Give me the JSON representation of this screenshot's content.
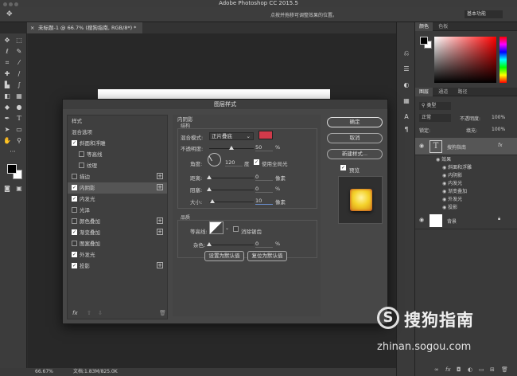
{
  "app": {
    "title": "Adobe Photoshop CC 2015.5"
  },
  "options_bar": {
    "hint": "点按并拖移可调整效果的位置。",
    "workspace": "基本功能"
  },
  "document": {
    "tab": "未标题-1 @ 66.7% (搜狗指南, RGB/8*) *"
  },
  "status": {
    "zoom": "66.67%",
    "doc": "文档:1.83M/825.0K"
  },
  "colors": {
    "accent_red": "#d03a4a",
    "fg": "#000000",
    "bg": "#ffffff"
  },
  "color_panel": {
    "tabs": [
      "颜色",
      "色板"
    ]
  },
  "layers_panel": {
    "tabs": [
      "图层",
      "通道",
      "路径"
    ],
    "kind": "类型",
    "blend": "正常",
    "opacity_label": "不透明度:",
    "opacity": "100%",
    "lock_label": "锁定:",
    "fill_label": "填充:",
    "fill": "100%",
    "text_layer": "搜狗指南",
    "effects_label": "效果",
    "effects": [
      "斜面和浮雕",
      "内阴影",
      "内发光",
      "渐变叠加",
      "外发光",
      "投影"
    ],
    "bg_layer": "背景"
  },
  "dialog": {
    "title": "图层样式",
    "styles_header": "样式",
    "blend_options": "混合选项",
    "items": [
      {
        "label": "斜面和浮雕",
        "checked": true,
        "plus": false,
        "indent": false
      },
      {
        "label": "等高线",
        "checked": false,
        "plus": false,
        "indent": true
      },
      {
        "label": "纹理",
        "checked": false,
        "plus": false,
        "indent": true
      },
      {
        "label": "描边",
        "checked": false,
        "plus": true,
        "indent": false
      },
      {
        "label": "内阴影",
        "checked": true,
        "plus": true,
        "indent": false,
        "selected": true
      },
      {
        "label": "内发光",
        "checked": true,
        "plus": false,
        "indent": false
      },
      {
        "label": "光泽",
        "checked": false,
        "plus": false,
        "indent": false
      },
      {
        "label": "颜色叠加",
        "checked": false,
        "plus": true,
        "indent": false
      },
      {
        "label": "渐变叠加",
        "checked": true,
        "plus": true,
        "indent": false
      },
      {
        "label": "图案叠加",
        "checked": false,
        "plus": false,
        "indent": false
      },
      {
        "label": "外发光",
        "checked": true,
        "plus": false,
        "indent": false
      },
      {
        "label": "投影",
        "checked": true,
        "plus": true,
        "indent": false
      }
    ],
    "fx": "fx",
    "inner_shadow": {
      "section": "内阴影",
      "structure": "结构",
      "blend_mode_label": "混合模式:",
      "blend_mode": "正片叠底",
      "opacity_label": "不透明度:",
      "opacity": "50",
      "angle_label": "角度:",
      "angle": "120",
      "degree": "度",
      "global_light": "使用全局光",
      "distance_label": "距离:",
      "distance": "0",
      "choke_label": "阻塞:",
      "choke": "0",
      "size_label": "大小:",
      "size": "10",
      "px": "像素",
      "pct": "%",
      "quality": "品质",
      "contour_label": "等高线:",
      "antialias": "消除锯齿",
      "noise_label": "杂色:",
      "noise": "0",
      "btn_default": "设置为默认值",
      "btn_reset": "复位为默认值"
    },
    "buttons": {
      "ok": "确定",
      "cancel": "取消",
      "new_style": "新建样式...",
      "preview": "预览"
    }
  },
  "watermark": {
    "cn": "搜狗指南",
    "url": "zhinan.sogou.com"
  }
}
